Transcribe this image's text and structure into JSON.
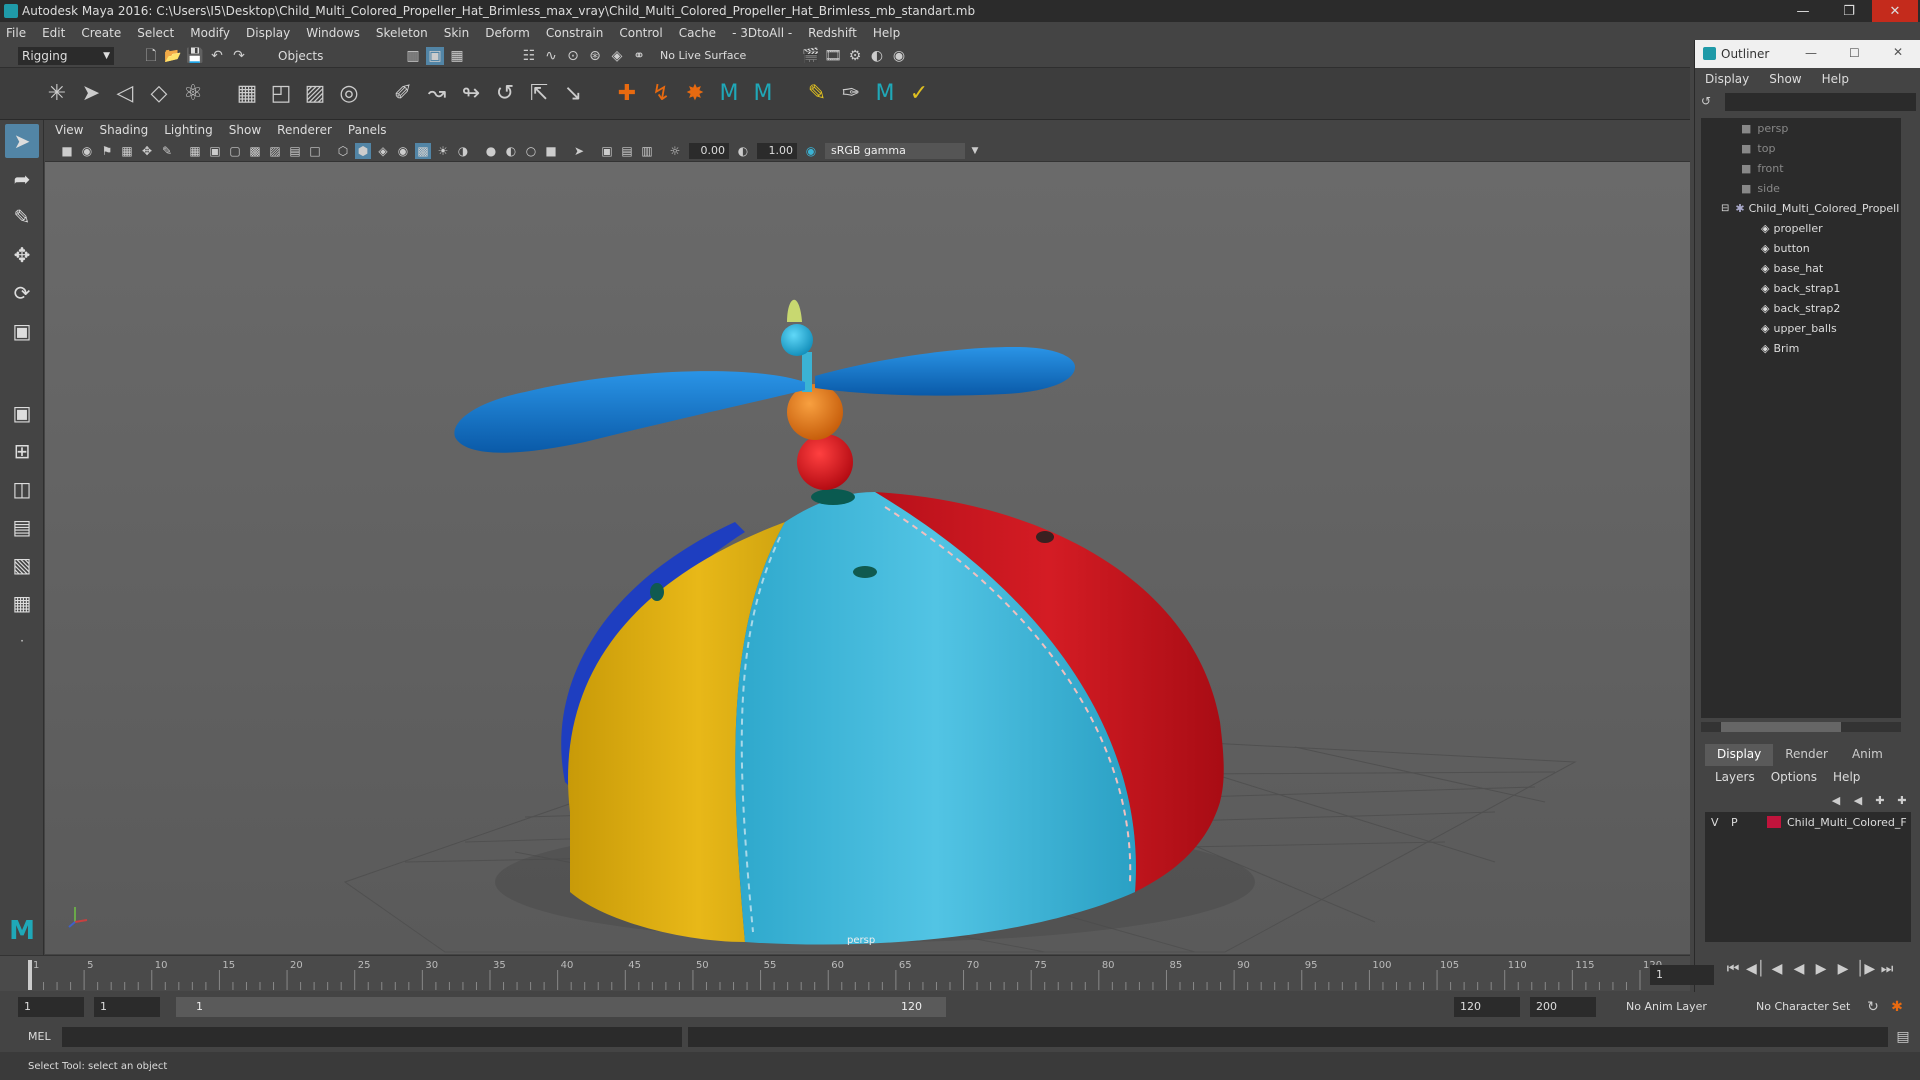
{
  "window": {
    "title": "Autodesk Maya 2016: C:\\Users\\I5\\Desktop\\Child_Multi_Colored_Propeller_Hat_Brimless_max_vray\\Child_Multi_Colored_Propeller_Hat_Brimless_mb_standart.mb"
  },
  "menubar": [
    "File",
    "Edit",
    "Create",
    "Select",
    "Modify",
    "Display",
    "Windows",
    "Skeleton",
    "Skin",
    "Deform",
    "Constrain",
    "Control",
    "Cache",
    "- 3DtoAll -",
    "Redshift",
    "Help"
  ],
  "statusline": {
    "mode": "Rigging",
    "select_mode": "Objects",
    "live_surface": "No Live Surface"
  },
  "viewport": {
    "menu": [
      "View",
      "Shading",
      "Lighting",
      "Show",
      "Renderer",
      "Panels"
    ],
    "exposure": "0.00",
    "gamma_value": "1.00",
    "color_space": "sRGB gamma",
    "camera_label": "persp"
  },
  "outliner": {
    "title": "Outliner",
    "menu": [
      "Display",
      "Show",
      "Help"
    ],
    "cameras": [
      "persp",
      "top",
      "front",
      "side"
    ],
    "group": "Child_Multi_Colored_Propell",
    "children": [
      "propeller",
      "button",
      "base_hat",
      "back_strap1",
      "back_strap2",
      "upper_balls",
      "Brim"
    ]
  },
  "layers": {
    "tabs": [
      "Display",
      "Render",
      "Anim"
    ],
    "menu": [
      "Layers",
      "Options",
      "Help"
    ],
    "layer_name": "Child_Multi_Colored_F",
    "visible_flag": "V",
    "playback_flag": "P",
    "layer_color": "#c0143c"
  },
  "timeline": {
    "ticks": [
      "1",
      "5",
      "10",
      "15",
      "20",
      "25",
      "30",
      "35",
      "40",
      "45",
      "50",
      "55",
      "60",
      "65",
      "70",
      "75",
      "80",
      "85",
      "90",
      "95",
      "100",
      "105",
      "110",
      "115",
      "120"
    ],
    "current_frame": "1"
  },
  "range": {
    "start": "1",
    "playback_start": "1",
    "slider_start": "1",
    "slider_end": "120",
    "playback_end": "120",
    "end": "200",
    "anim_layer": "No Anim Layer",
    "character_set": "No Character Set"
  },
  "cmdline": {
    "label": "MEL"
  },
  "helpline": {
    "text": "Select Tool: select an object"
  },
  "colors": {
    "accent": "#5285a6",
    "hat_yellow": "#e0b310",
    "hat_blue": "#3bb3d4",
    "hat_red": "#c8141c",
    "propeller_blue": "#0a72c8"
  }
}
